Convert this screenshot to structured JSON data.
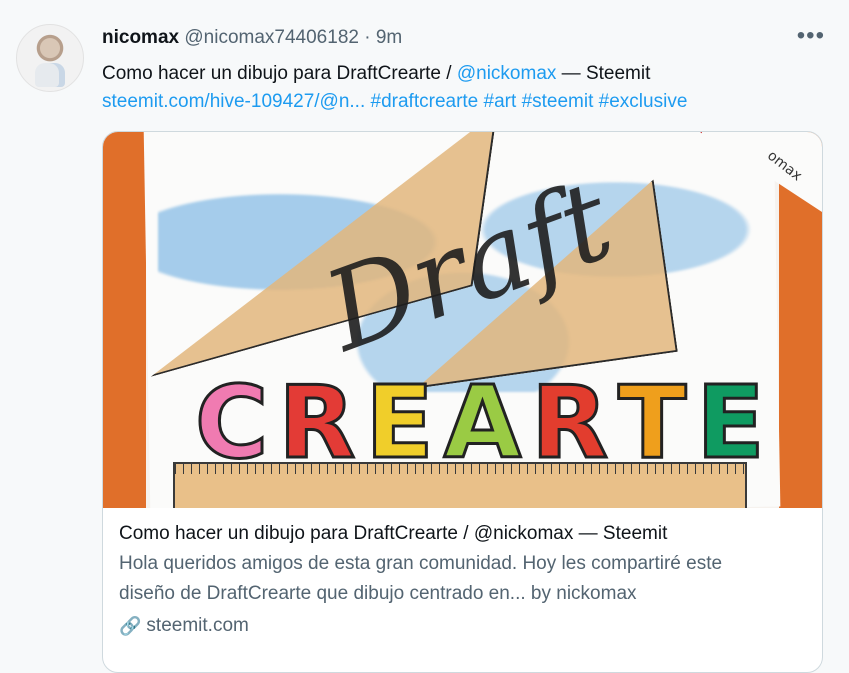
{
  "tweet": {
    "name": "nicomax",
    "handle": "@nicomax74406182",
    "dot": "·",
    "time": "9m",
    "more_icon": "•••",
    "text_line_1_prefix": "Como hacer un dibujo para DraftCrearte / ",
    "mention": "@nickomax",
    "text_line_1_suffix": " — Steemit",
    "link_line": "steemit.com/hive-109427/@n...",
    "hashtags": [
      "#draftcrearte",
      "#art",
      "#steemit",
      "#exclusive"
    ]
  },
  "card": {
    "title": "Como hacer un dibujo para DraftCrearte / @nickomax — Steemit",
    "description_line_1": "Hola queridos amigos de esta gran comunidad. Hoy les compartiré este",
    "description_line_2": "diseño de DraftCrearte que dibujo centrado en... by nickomax",
    "domain": "steemit.com",
    "link_icon": "🔗",
    "image_word_top": "Draft",
    "image_letters": [
      "C",
      "R",
      "E",
      "A",
      "R",
      "T",
      "E"
    ],
    "image_corner_text": "omax"
  },
  "colors": {
    "accent": "#1d9bf0",
    "muted": "#536471",
    "letter_colors": [
      "#f07bb1",
      "#e33b36",
      "#f0ce2a",
      "#9acb44",
      "#e23d2e",
      "#ef9f1c",
      "#0f9b61"
    ]
  }
}
